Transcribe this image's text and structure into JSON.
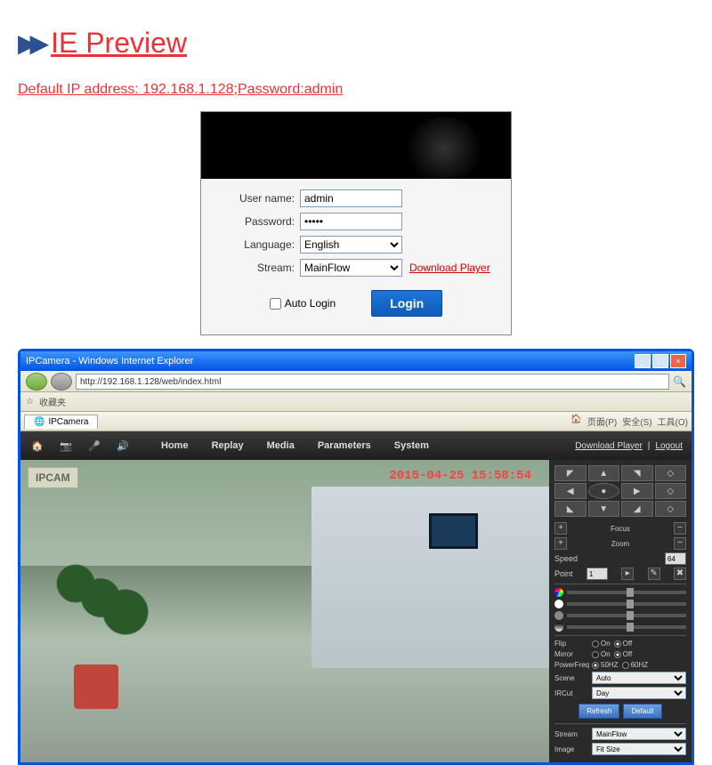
{
  "header": {
    "title": "IE Preview",
    "credentials": "Default IP address: 192.168.1.128;Password:admin"
  },
  "login": {
    "user_label": "User name:",
    "user_value": "admin",
    "pass_label": "Password:",
    "pass_value": "•••••",
    "lang_label": "Language:",
    "lang_value": "English",
    "stream_label": "Stream:",
    "stream_value": "MainFlow",
    "download_link": "Download Player",
    "auto_login": "Auto Login",
    "login_btn": "Login"
  },
  "browser": {
    "window_title": "IPCamera - Windows Internet Explorer",
    "url": "http://192.168.1.128/web/index.html",
    "fav_label": "收藏夹",
    "tab_label": "IPCamera",
    "tools": [
      "页面(P)",
      "安全(S)",
      "工具(O)"
    ]
  },
  "app": {
    "nav": [
      "Home",
      "Replay",
      "Media",
      "Parameters",
      "System"
    ],
    "links": {
      "download": "Download Player",
      "logout": "Logout"
    },
    "video": {
      "badge": "IPCAM",
      "timestamp": "2015-04-25 15:58:54"
    },
    "controls": {
      "focus": "Focus",
      "zoom": "Zoom",
      "speed_label": "Speed",
      "speed_value": "64",
      "point_label": "Point",
      "point_value": "1",
      "flip": "Flip",
      "mirror": "Mirror",
      "powerfreq": "PowerFreq",
      "scene": "Scene",
      "ircut": "IRCut",
      "on": "On",
      "off": "Off",
      "hz50": "50HZ",
      "hz60": "60HZ",
      "scene_value": "Auto",
      "ircut_value": "Day",
      "refresh": "Refresh",
      "default": "Default",
      "stream_label": "Stream",
      "stream_value": "MainFlow",
      "image_label": "Image",
      "image_value": "Fit Size"
    }
  }
}
